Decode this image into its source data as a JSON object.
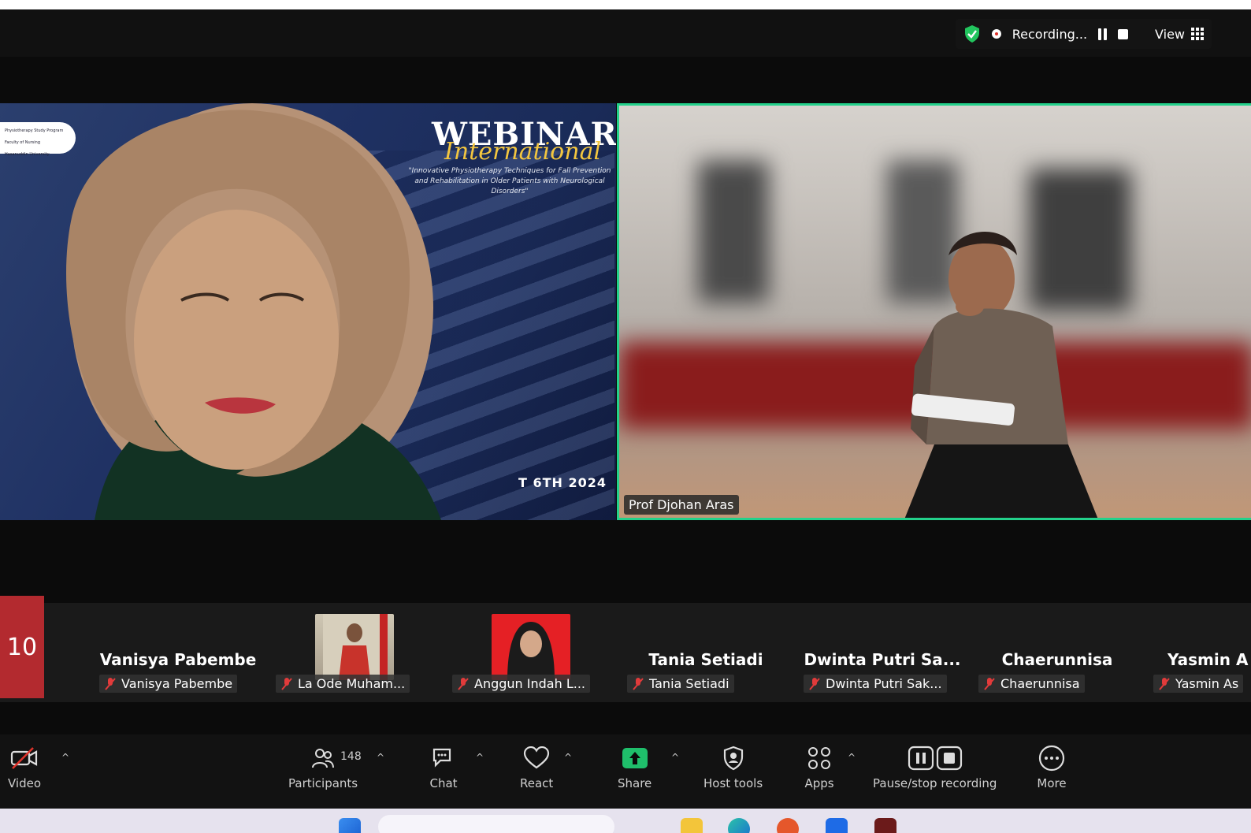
{
  "topbar": {
    "recording_label": "Recording...",
    "view_label": "View",
    "shield_color": "#22c55e",
    "rec_color": "#e0332b"
  },
  "slide": {
    "badge_lines": [
      "Physiotherapy Study Program",
      "Faculty of Nursing",
      "Hasanuddin University"
    ],
    "title": "WEBINAR",
    "subtitle": "International",
    "description": "\"Innovative Physiotherapy Techniques for Fall Prevention and Rehabilitation in Older Patients with Neurological Disorders\"",
    "date": "T 6TH 2024"
  },
  "speaker": {
    "name": "Prof Djohan Aras",
    "border_color": "#23d18b"
  },
  "gallery": {
    "page_number": "10",
    "tiles": [
      {
        "display": "",
        "label": "Vanisya Pabembe",
        "heading": "Vanisya Pabembe"
      },
      {
        "display": "photo",
        "label": "La Ode Muham...",
        "heading": ""
      },
      {
        "display": "photo",
        "label": "Anggun Indah L...",
        "heading": ""
      },
      {
        "display": "",
        "label": "Tania Setiadi",
        "heading": "Tania Setiadi"
      },
      {
        "display": "",
        "label": "Dwinta Putri Sak...",
        "heading": "Dwinta Putri Sa..."
      },
      {
        "display": "",
        "label": "Chaerunnisa",
        "heading": "Chaerunnisa"
      },
      {
        "display": "",
        "label": "Yasmin As",
        "heading": "Yasmin A"
      }
    ]
  },
  "toolbar": {
    "video": "Video",
    "participants": "Participants",
    "participant_count": "148",
    "chat": "Chat",
    "react": "React",
    "share": "Share",
    "host_tools": "Host tools",
    "apps": "Apps",
    "pause_stop": "Pause/stop recording",
    "more": "More",
    "share_color": "#1fbf6b"
  }
}
